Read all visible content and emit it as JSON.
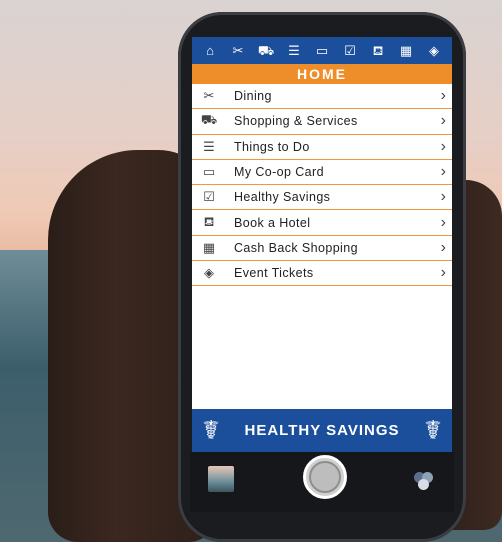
{
  "topbar": {
    "icons": [
      "home-icon",
      "dining-icon",
      "shopping-cart-icon",
      "list-icon",
      "card-icon",
      "clipboard-icon",
      "hotel-bed-icon",
      "cash-register-icon",
      "ticket-icon"
    ],
    "glyphs": [
      "⌂",
      "✂",
      "⛟",
      "☰",
      "▭",
      "☑",
      "⛾",
      "▦",
      "◈"
    ]
  },
  "header": {
    "title": "HOME"
  },
  "menu": {
    "items": [
      {
        "label": "Dining",
        "icon": "✂"
      },
      {
        "label": "Shopping & Services",
        "icon": "⛟"
      },
      {
        "label": "Things to Do",
        "icon": "☰"
      },
      {
        "label": "My Co-op Card",
        "icon": "▭"
      },
      {
        "label": "Healthy Savings",
        "icon": "☑"
      },
      {
        "label": "Book a Hotel",
        "icon": "⛾"
      },
      {
        "label": "Cash Back Shopping",
        "icon": "▦"
      },
      {
        "label": "Event Tickets",
        "icon": "◈"
      }
    ],
    "chevron": "›"
  },
  "banner": {
    "text": "HEALTHY SAVINGS",
    "icon": "☤"
  },
  "colors": {
    "primary": "#1b4f9c",
    "accent": "#ee8e2a"
  }
}
